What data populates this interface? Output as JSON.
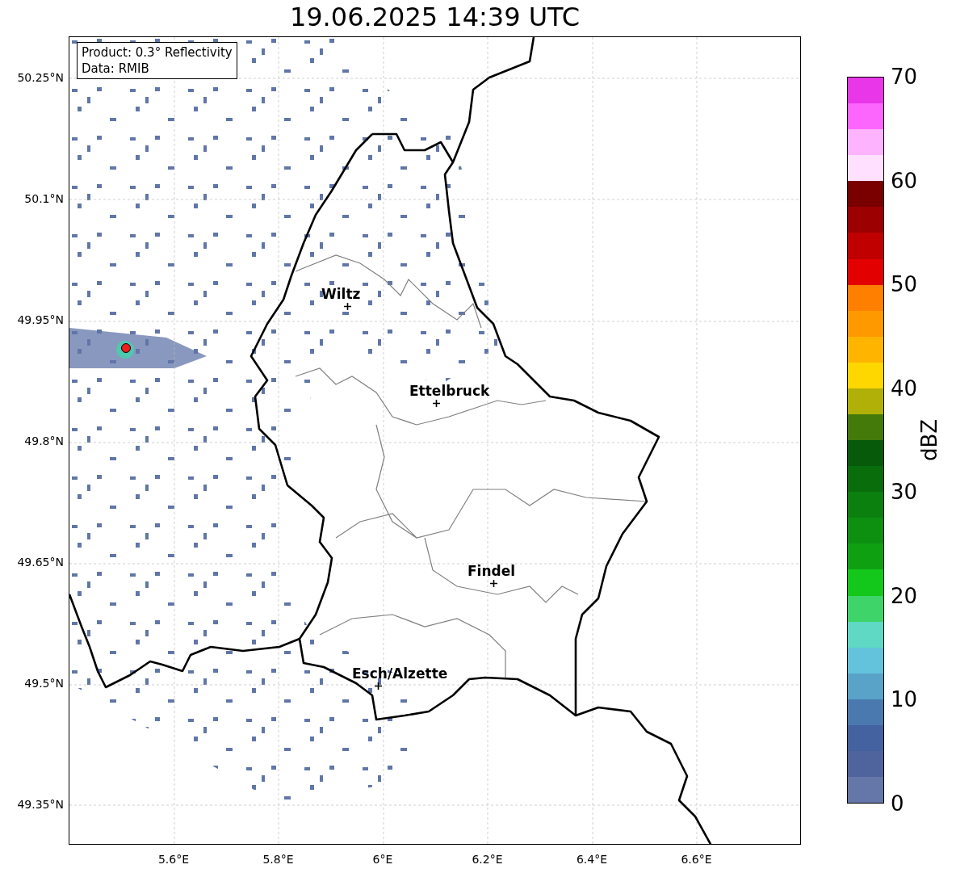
{
  "title": "19.06.2025 14:39 UTC",
  "info_box": [
    "Product: 0.3° Reflectivity",
    "Data: RMIB"
  ],
  "map": {
    "cities": [
      {
        "name": "Wiltz"
      },
      {
        "name": "Ettelbruck"
      },
      {
        "name": "Findel"
      },
      {
        "name": "Esch/Alzette"
      }
    ]
  },
  "y_ticks": [
    "50.25°N",
    "50.1°N",
    "49.95°N",
    "49.8°N",
    "49.65°N",
    "49.5°N",
    "49.35°N"
  ],
  "x_ticks": [
    "5.6°E",
    "5.8°E",
    "6°E",
    "6.2°E",
    "6.4°E",
    "6.6°E"
  ],
  "colorbar": {
    "label": "dBZ",
    "ticks": [
      "70",
      "60",
      "50",
      "40",
      "30",
      "20",
      "10",
      "0"
    ],
    "segments": [
      {
        "color": "#e936e9"
      },
      {
        "color": "#fd66fd"
      },
      {
        "color": "#feb3fe"
      },
      {
        "color": "#ffe0ff"
      },
      {
        "color": "#7a0000"
      },
      {
        "color": "#9c0000"
      },
      {
        "color": "#c00000"
      },
      {
        "color": "#e20000"
      },
      {
        "color": "#ff7f00"
      },
      {
        "color": "#ff9900"
      },
      {
        "color": "#ffb400"
      },
      {
        "color": "#ffd700"
      },
      {
        "color": "#b0b008"
      },
      {
        "color": "#437a0a"
      },
      {
        "color": "#075a0a"
      },
      {
        "color": "#096d0c"
      },
      {
        "color": "#0b800e"
      },
      {
        "color": "#0d9010"
      },
      {
        "color": "#0fa012"
      },
      {
        "color": "#13c81a"
      },
      {
        "color": "#3ed46a"
      },
      {
        "color": "#5fd8c4"
      },
      {
        "color": "#63c2dc"
      },
      {
        "color": "#59a2c8"
      },
      {
        "color": "#4a79b0"
      },
      {
        "color": "#4461a0"
      },
      {
        "color": "#4f639c"
      },
      {
        "color": "#6577a8"
      }
    ]
  }
}
